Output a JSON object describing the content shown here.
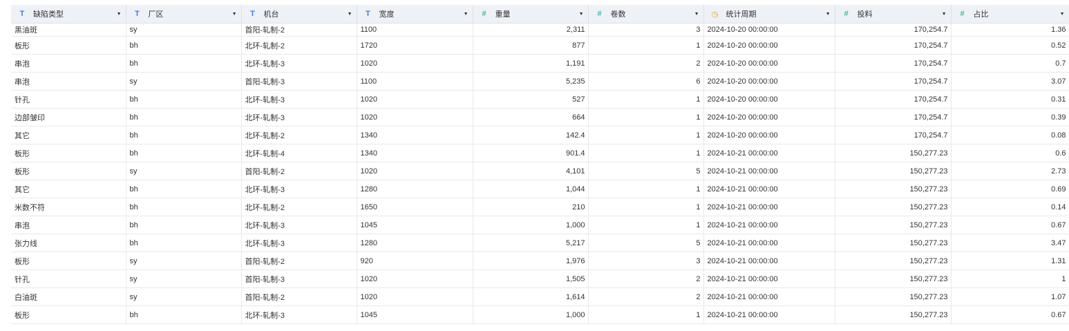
{
  "columns": [
    {
      "label": "缺陷类型",
      "type": "text",
      "icon": "text-type-icon"
    },
    {
      "label": "厂区",
      "type": "text",
      "icon": "text-type-icon"
    },
    {
      "label": "机台",
      "type": "text",
      "icon": "text-type-icon"
    },
    {
      "label": "宽度",
      "type": "text",
      "icon": "text-type-icon"
    },
    {
      "label": "重量",
      "type": "number",
      "icon": "number-type-icon"
    },
    {
      "label": "卷数",
      "type": "number",
      "icon": "number-type-icon"
    },
    {
      "label": "统计周期",
      "type": "datetime",
      "icon": "datetime-type-icon"
    },
    {
      "label": "投料",
      "type": "number",
      "icon": "number-type-icon"
    },
    {
      "label": "占比",
      "type": "number",
      "icon": "number-type-icon"
    }
  ],
  "icons": {
    "text": "T",
    "number": "#",
    "datetime": "◷",
    "caret": "▼"
  },
  "rows": [
    [
      "黑油斑",
      "sy",
      "首阳-轧制-2",
      "1100",
      "2,311",
      "3",
      "2024-10-20 00:00:00",
      "170,254.7",
      "1.36"
    ],
    [
      "板形",
      "bh",
      "北环-轧制-2",
      "1720",
      "877",
      "1",
      "2024-10-20 00:00:00",
      "170,254.7",
      "0.52"
    ],
    [
      "串泡",
      "bh",
      "北环-轧制-3",
      "1020",
      "1,191",
      "2",
      "2024-10-20 00:00:00",
      "170,254.7",
      "0.7"
    ],
    [
      "串泡",
      "sy",
      "首阳-轧制-3",
      "1100",
      "5,235",
      "6",
      "2024-10-20 00:00:00",
      "170,254.7",
      "3.07"
    ],
    [
      "针孔",
      "bh",
      "北环-轧制-3",
      "1020",
      "527",
      "1",
      "2024-10-20 00:00:00",
      "170,254.7",
      "0.31"
    ],
    [
      "边部皱印",
      "bh",
      "北环-轧制-3",
      "1020",
      "664",
      "1",
      "2024-10-20 00:00:00",
      "170,254.7",
      "0.39"
    ],
    [
      "其它",
      "bh",
      "北环-轧制-2",
      "1340",
      "142.4",
      "1",
      "2024-10-20 00:00:00",
      "170,254.7",
      "0.08"
    ],
    [
      "板形",
      "bh",
      "北环-轧制-4",
      "1340",
      "901.4",
      "1",
      "2024-10-21 00:00:00",
      "150,277.23",
      "0.6"
    ],
    [
      "板形",
      "sy",
      "首阳-轧制-2",
      "1020",
      "4,101",
      "5",
      "2024-10-21 00:00:00",
      "150,277.23",
      "2.73"
    ],
    [
      "其它",
      "bh",
      "北环-轧制-3",
      "1280",
      "1,044",
      "1",
      "2024-10-21 00:00:00",
      "150,277.23",
      "0.69"
    ],
    [
      "米数不符",
      "bh",
      "北环-轧制-2",
      "1650",
      "210",
      "1",
      "2024-10-21 00:00:00",
      "150,277.23",
      "0.14"
    ],
    [
      "串泡",
      "bh",
      "北环-轧制-3",
      "1045",
      "1,000",
      "1",
      "2024-10-21 00:00:00",
      "150,277.23",
      "0.67"
    ],
    [
      "张力线",
      "bh",
      "北环-轧制-3",
      "1280",
      "5,217",
      "5",
      "2024-10-21 00:00:00",
      "150,277.23",
      "3.47"
    ],
    [
      "板形",
      "sy",
      "首阳-轧制-2",
      "920",
      "1,976",
      "3",
      "2024-10-21 00:00:00",
      "150,277.23",
      "1.31"
    ],
    [
      "针孔",
      "sy",
      "首阳-轧制-3",
      "1020",
      "1,505",
      "2",
      "2024-10-21 00:00:00",
      "150,277.23",
      "1"
    ],
    [
      "白油斑",
      "sy",
      "首阳-轧制-2",
      "1020",
      "1,614",
      "2",
      "2024-10-21 00:00:00",
      "150,277.23",
      "1.07"
    ],
    [
      "板形",
      "bh",
      "北环-轧制-3",
      "1045",
      "1,000",
      "1",
      "2024-10-21 00:00:00",
      "150,277.23",
      "0.67"
    ]
  ],
  "colors": {
    "header_bg": "#eef1f6",
    "text_icon": "#3b7df0",
    "number_icon": "#3ab8a8",
    "date_icon": "#f0a028"
  }
}
